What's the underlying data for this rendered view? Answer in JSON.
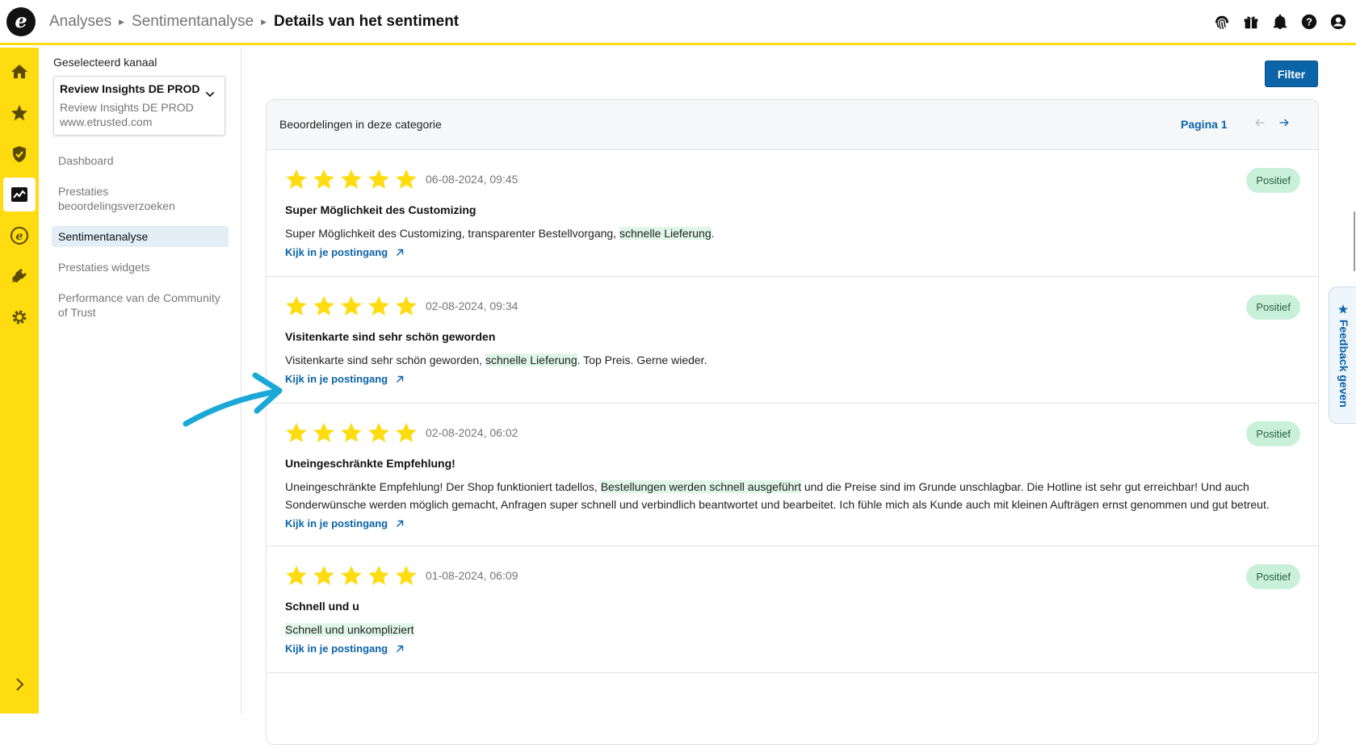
{
  "header": {
    "breadcrumb": [
      "Analyses",
      "Sentimentanalyse"
    ],
    "current": "Details van het sentiment",
    "icons": [
      "fingerprint-icon",
      "gift-icon",
      "bell-icon",
      "help-icon",
      "account-icon"
    ]
  },
  "rail": {
    "icons": [
      "home-icon",
      "star-icon",
      "shield-check-icon",
      "analytics-icon",
      "etrusted-icon",
      "plug-icon",
      "gear-icon",
      "chevron-right-icon"
    ],
    "active": "analytics-icon"
  },
  "sidebar": {
    "label": "Geselecteerd kanaal",
    "channel": {
      "title": "Review Insights DE PROD",
      "subtitle": "Review Insights DE PROD",
      "url": "www.etrusted.com"
    },
    "items": [
      {
        "label": "Dashboard",
        "active": false
      },
      {
        "label": "Prestaties beoordelingsverzoeken",
        "active": false
      },
      {
        "label": "Sentimentanalyse",
        "active": true
      },
      {
        "label": "Prestaties widgets",
        "active": false
      },
      {
        "label": "Performance van de Community of Trust",
        "active": false
      }
    ]
  },
  "main": {
    "filter_label": "Filter",
    "card_title": "Beoordelingen in deze categorie",
    "page_label": "Pagina 1",
    "link_label": "Kijk in je postingang",
    "reviews": [
      {
        "rating": 5,
        "date": "06-08-2024, 09:45",
        "sentiment": "Positief",
        "title": "Super Möglichkeit des Customizing",
        "text_before": "Super Möglichkeit des Customizing, transparenter Bestellvorgang, ",
        "highlight": "schnelle Lieferung",
        "text_after": "."
      },
      {
        "rating": 5,
        "date": "02-08-2024, 09:34",
        "sentiment": "Positief",
        "title": "Visitenkarte sind sehr schön geworden",
        "text_before": "Visitenkarte sind sehr schön geworden, ",
        "highlight": "schnelle Lieferung",
        "text_after": ". Top Preis. Gerne wieder."
      },
      {
        "rating": 5,
        "date": "02-08-2024, 06:02",
        "sentiment": "Positief",
        "title": "Uneingeschränkte Empfehlung!",
        "text_before": "Uneingeschränkte Empfehlung! Der Shop funktioniert tadellos, ",
        "highlight": "Bestellungen werden schnell ausgeführt",
        "text_after": "  und die Preise sind im Grunde unschlagbar. Die Hotline ist sehr gut erreichbar! Und auch Sonderwünsche werden möglich gemacht, Anfragen super schnell und verbindlich beantwortet und bearbeitet. Ich fühle mich als Kunde auch mit kleinen Aufträgen ernst genommen und gut betreut."
      },
      {
        "rating": 5,
        "date": "01-08-2024, 06:09",
        "sentiment": "Positief",
        "title": "Schnell und u",
        "text_before": "",
        "highlight": "Schnell und unkompliziert",
        "text_after": ""
      }
    ]
  },
  "feedback_label": "★ Feedback geven",
  "colors": {
    "brand_yellow": "#ffdc0f",
    "link_blue": "#0b63a8",
    "star_yellow": "#ffdc0f",
    "badge_green": "#c9f1da",
    "highlight_green": "#dff6e8",
    "annotation_arrow": "#1aa9d6"
  }
}
